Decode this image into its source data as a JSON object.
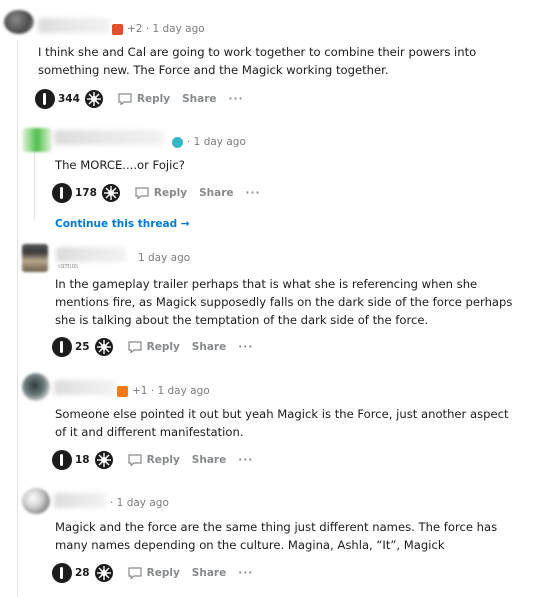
{
  "comments": [
    {
      "meta": "+2 · 1 day ago",
      "body": "I think she and Cal are going to work together to combine their powers into\nsomething new. The Force and the Magick working together.",
      "count": "344",
      "reply": "Reply",
      "share": "Share",
      "more": "···"
    },
    {
      "meta": "· 1 day ago",
      "body": "The MORCE....or Fojic?",
      "count": "178",
      "reply": "Reply",
      "share": "Share",
      "more": "···"
    },
    {
      "meta": "1 day ago",
      "body": "In the gameplay trailer perhaps that is what she is referencing when she\nmentions fire, as Magick supposedly falls on the dark side of the force perhaps\nshe is talking about the temptation of the dark side of the force.",
      "count": "25",
      "reply": "Reply",
      "share": "Share",
      "more": "···"
    },
    {
      "meta": "+1 · 1 day ago",
      "body": "Someone else pointed it out but yeah Magick is the Force, just another aspect\nof it and different manifestation.",
      "count": "18",
      "reply": "Reply",
      "share": "Share",
      "more": "···"
    },
    {
      "meta": "· 1 day ago",
      "body": "Magick and the force are the same thing just different names. The force has\nmany names depending on the culture. Magina, Ashla, “It”, Magick",
      "count": "28",
      "reply": "Reply",
      "share": "Share",
      "more": "···"
    }
  ],
  "continue_thread": "Continue this thread →",
  "tiny_name": "ιαπιαι"
}
